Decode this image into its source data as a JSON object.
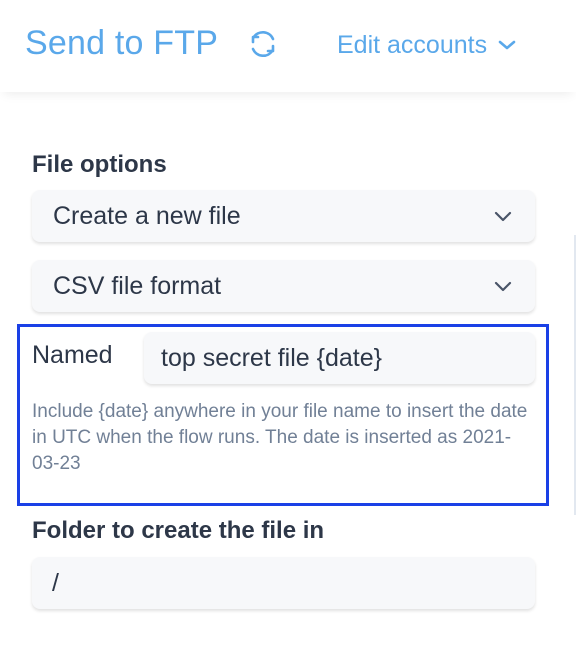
{
  "header": {
    "title": "Send to FTP",
    "refresh_icon": "refresh-icon",
    "edit_accounts_label": "Edit accounts",
    "accent_color": "#5aa8ea"
  },
  "file_options": {
    "label": "File options",
    "mode_select": {
      "value": "Create a new file",
      "icon": "chevron-down-icon"
    },
    "format_select": {
      "value": "CSV file format",
      "icon": "chevron-down-icon"
    }
  },
  "named": {
    "label": "Named",
    "value": "top secret file {date}",
    "help": "Include {date} anywhere in your file name to insert the date in UTC when the flow runs. The date is inserted as 2021-03-23",
    "highlight_color": "#1a40e6"
  },
  "folder": {
    "label": "Folder to create the file in",
    "value": "/"
  }
}
